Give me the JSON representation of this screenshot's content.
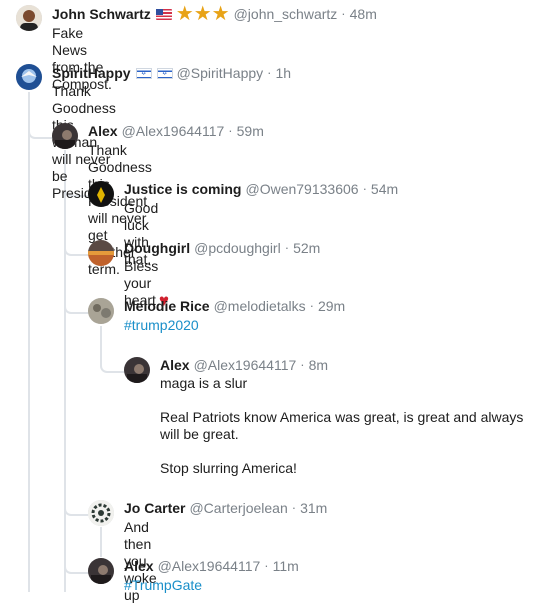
{
  "comments": [
    {
      "id": "c1",
      "name": "John Schwartz",
      "flags": [
        "us"
      ],
      "stars": "★★★",
      "handle": "@john_schwartz",
      "time": "48m",
      "body": "Fake News from the Compost.",
      "avatar_color": "#7b4a2e"
    },
    {
      "id": "c2",
      "name": "SpiritHappy",
      "flags": [
        "il",
        "il"
      ],
      "handle": "@SpiritHappy",
      "time": "1h",
      "body": "Thank Goodness this woman will never be President",
      "avatar_color": "#2b5aa0"
    },
    {
      "id": "c3",
      "name": "Alex",
      "handle": "@Alex19644117",
      "time": "59m",
      "body": "Thank Goodness this President will never get another term.",
      "avatar_color": "#3a3436"
    },
    {
      "id": "c4",
      "name": "Justice is coming",
      "handle": "@Owen79133606",
      "time": "54m",
      "body": "Good luck with that.",
      "avatar_color": "#111111"
    },
    {
      "id": "c5",
      "name": "Doughgirl",
      "handle": "@pcdoughgirl",
      "time": "52m",
      "body": "Bless your heart",
      "heart": "♥",
      "avatar_color": "#b5532a"
    },
    {
      "id": "c6",
      "name": "Melodie Rice",
      "handle": "@melodietalks",
      "time": "29m",
      "hashtag": "#trump2020",
      "avatar_color": "#8f8a7e"
    },
    {
      "id": "c7",
      "name": "Alex",
      "handle": "@Alex19644117",
      "time": "8m",
      "paragraphs": [
        "maga is a slur",
        "Real Patriots know America was great, is great and always will be great.",
        "Stop slurring America!"
      ],
      "avatar_color": "#3a3436"
    },
    {
      "id": "c8",
      "name": "Jo Carter",
      "handle": "@Carterjoelean",
      "time": "31m",
      "body": "And then you woke up",
      "avatar_color": "#2d3a35"
    },
    {
      "id": "c9",
      "name": "Alex",
      "handle": "@Alex19644117",
      "time": "11m",
      "hashtag": "#TrumpGate",
      "avatar_color": "#3a3436"
    }
  ],
  "separator": "·",
  "colors": {
    "hashtag": "#1a8fc9",
    "thread_line": "#dfe3e8",
    "meta": "#7a8188",
    "star": "#e8a317",
    "heart": "#d0202e"
  }
}
